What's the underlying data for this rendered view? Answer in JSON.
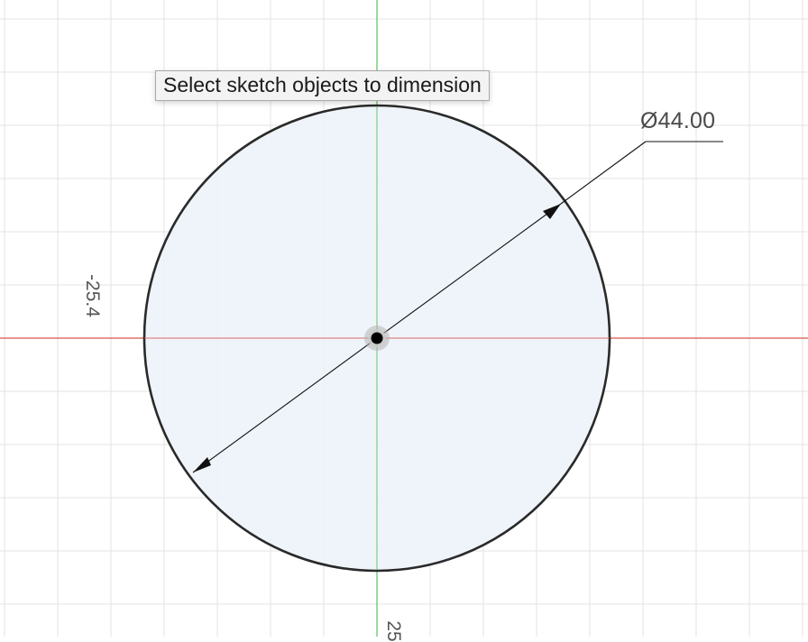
{
  "tooltip": {
    "text": "Select sketch objects to dimension"
  },
  "dimension": {
    "label": "Ø44.00",
    "type": "diameter",
    "value": 44.0
  },
  "rulers": {
    "left_label": "-25.4",
    "bottom_label": "25"
  },
  "sketch": {
    "shape": "circle",
    "diameter": 44.0,
    "center": "origin"
  },
  "colors": {
    "x_axis": "#d9534a",
    "y_axis": "#5cc15c",
    "grid": "#e3e3e3",
    "circle_fill": "#edf3fa",
    "circle_stroke": "#2a2a2a",
    "dimension_line": "#111111"
  },
  "icons": [
    "origin-point-icon",
    "arrowhead-icon"
  ]
}
